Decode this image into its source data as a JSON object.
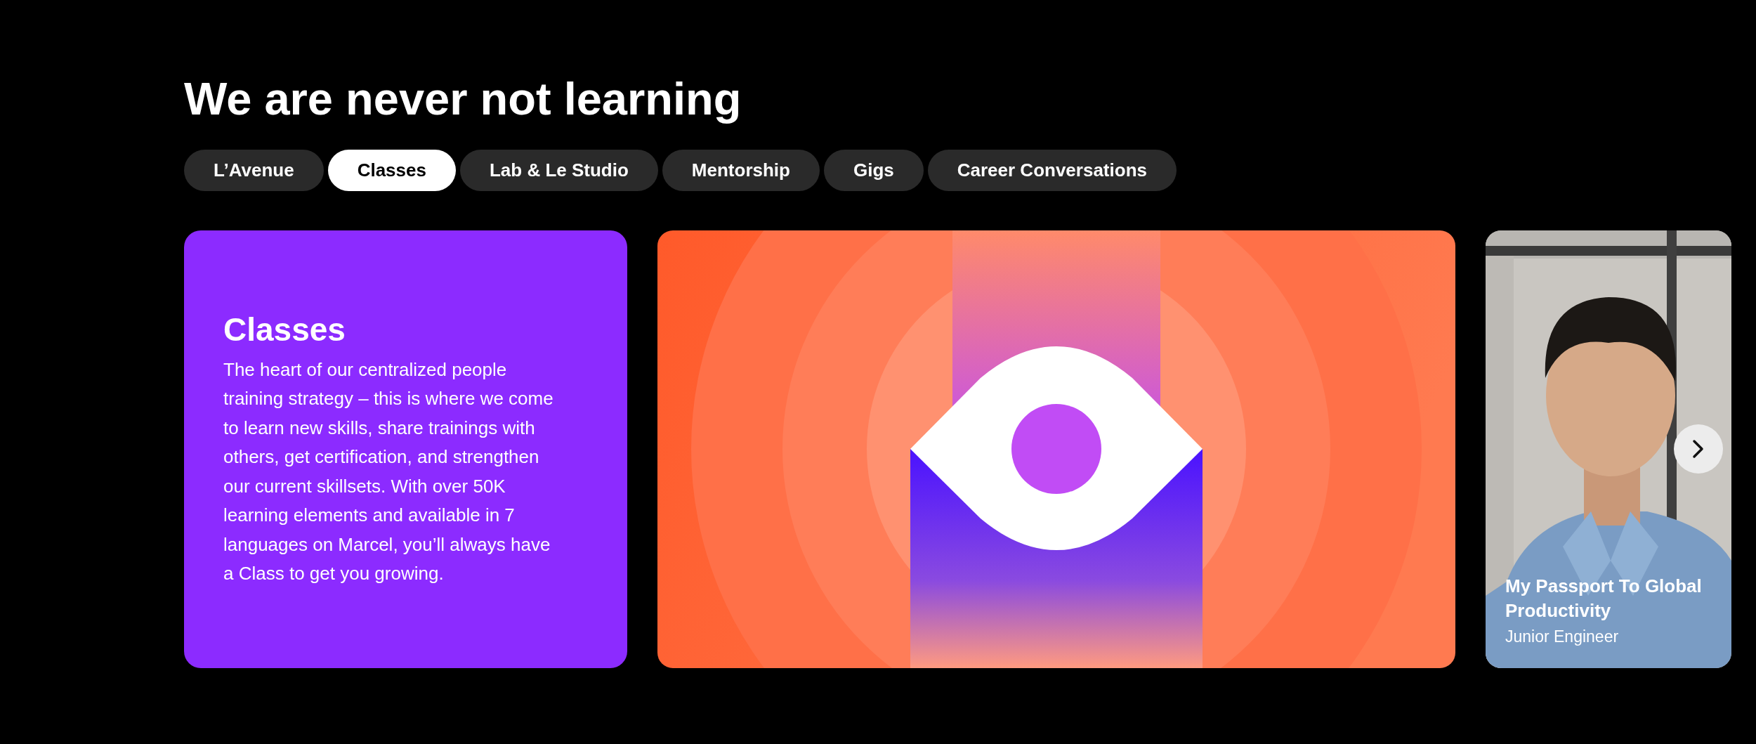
{
  "heading": "We are never not learning",
  "tabs": [
    {
      "label": "L’Avenue",
      "selected": false
    },
    {
      "label": "Classes",
      "selected": true
    },
    {
      "label": "Lab & Le Studio",
      "selected": false
    },
    {
      "label": "Mentorship",
      "selected": false
    },
    {
      "label": "Gigs",
      "selected": false
    },
    {
      "label": "Career Conversations",
      "selected": false
    }
  ],
  "feature": {
    "title": "Classes",
    "text": "The heart of our centralized people training strategy – this is where we come to learn new skills, share trainings with others, get certification, and strengthen our current skillsets. With over 50K learning elements and available in 7 languages on Marcel, you’ll always have a Class to get you growing."
  },
  "story": {
    "title": "My Passport To Global Productivity",
    "subtitle": "Junior Engineer"
  }
}
